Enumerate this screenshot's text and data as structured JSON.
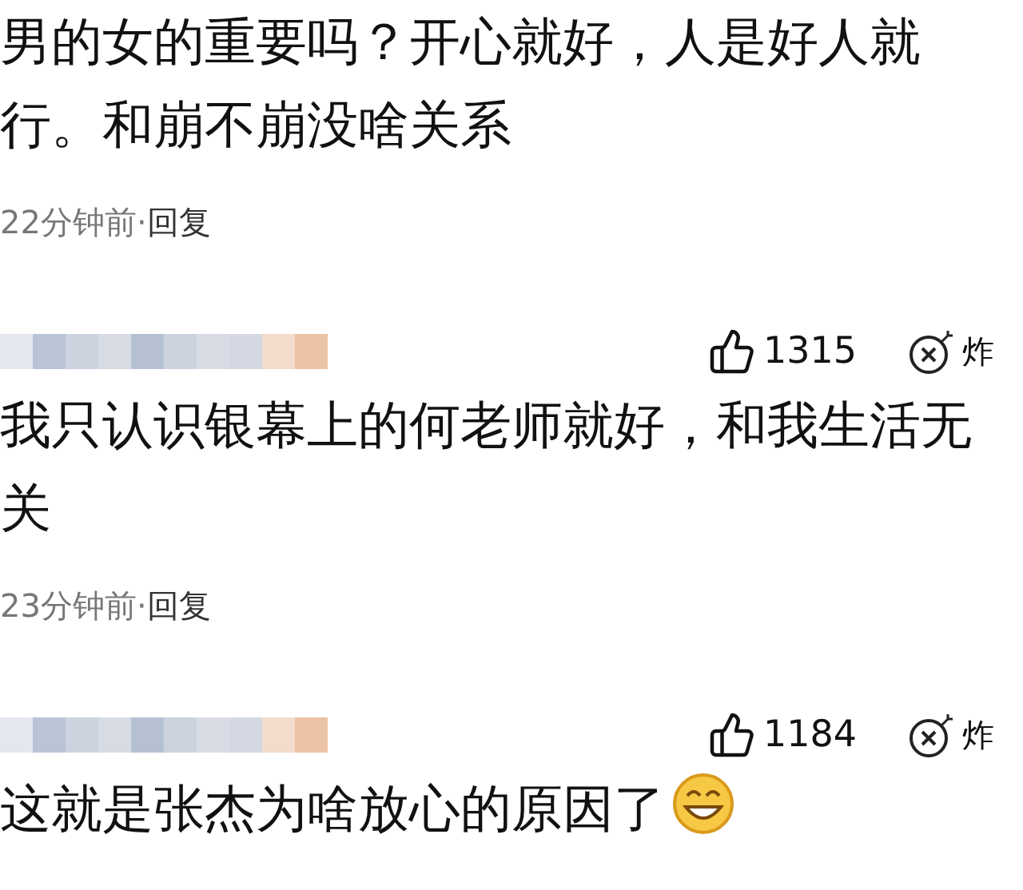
{
  "comments": [
    {
      "text": "男的女的重要吗？开心就好，人是好人就行。和崩不崩没啥关系",
      "time": "22分钟前",
      "separator": "·",
      "reply": "回复"
    },
    {
      "likes": "1315",
      "bomb_label": "炸",
      "text": "我只认识银幕上的何老师就好，和我生活无关",
      "time": "23分钟前",
      "separator": "·",
      "reply": "回复"
    },
    {
      "likes": "1184",
      "bomb_label": "炸",
      "text": "这就是张杰为啥放心的原因了",
      "emoji": true
    }
  ]
}
